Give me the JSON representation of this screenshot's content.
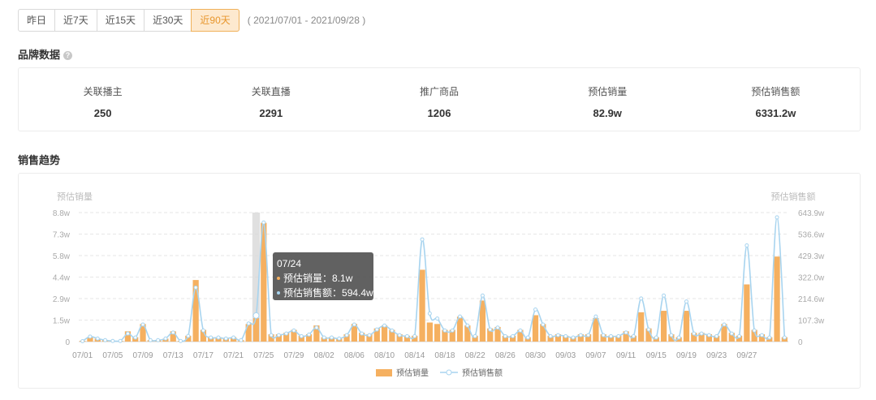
{
  "range": {
    "buttons": [
      "昨日",
      "近7天",
      "近15天",
      "近30天",
      "近90天"
    ],
    "active_index": 4,
    "date_text": "( 2021/07/01 - 2021/09/28 )"
  },
  "brand_section": {
    "title": "品牌数据",
    "help_icon": "question-circle-icon",
    "stats": [
      {
        "label": "关联播主",
        "value": "250"
      },
      {
        "label": "关联直播",
        "value": "2291"
      },
      {
        "label": "推广商品",
        "value": "1206"
      },
      {
        "label": "预估销量",
        "value": "82.9w"
      },
      {
        "label": "预估销售额",
        "value": "6331.2w"
      }
    ]
  },
  "trend_section": {
    "title": "销售趋势"
  },
  "tooltip": {
    "date": "07/24",
    "rows": [
      {
        "label": "预估销量：",
        "value": "8.1w",
        "color": "#f5b060"
      },
      {
        "label": "预估销售额：",
        "value": "594.4w",
        "color": "#a8d4ef"
      }
    ]
  },
  "chart_data": {
    "type": "bar+line",
    "left_axis_title": "预估销量",
    "right_axis_title": "预估销售额",
    "left_ticks": [
      "0",
      "1.5w",
      "2.9w",
      "4.4w",
      "5.8w",
      "7.3w",
      "8.8w"
    ],
    "right_ticks": [
      "0",
      "107.3w",
      "214.6w",
      "322.0w",
      "429.3w",
      "536.6w",
      "643.9w"
    ],
    "ylim_left": [
      0,
      8.8
    ],
    "ylim_right": [
      0,
      643.9
    ],
    "x_tick_labels": [
      "07/01",
      "07/05",
      "07/09",
      "07/13",
      "07/17",
      "07/21",
      "07/25",
      "07/29",
      "08/02",
      "08/06",
      "08/10",
      "08/14",
      "08/18",
      "08/22",
      "08/26",
      "08/30",
      "09/03",
      "09/07",
      "09/11",
      "09/15",
      "09/19",
      "09/23",
      "09/27"
    ],
    "x_start": "07/01",
    "highlight_index": 23,
    "grid": true,
    "legend_position": "bottom",
    "series": [
      {
        "name": "预估销量",
        "type": "bar",
        "color": "#f5b060",
        "values": [
          0.05,
          0.3,
          0.2,
          0.1,
          0.05,
          0.05,
          0.7,
          0.3,
          1.2,
          0.1,
          0.1,
          0.2,
          0.7,
          0.05,
          0.4,
          4.2,
          0.8,
          0.3,
          0.3,
          0.2,
          0.3,
          0.1,
          1.2,
          1.6,
          8.1,
          0.5,
          0.5,
          0.6,
          0.8,
          0.4,
          0.5,
          1.1,
          0.3,
          0.3,
          0.2,
          0.5,
          1.2,
          0.6,
          0.5,
          0.9,
          1.1,
          0.8,
          0.5,
          0.4,
          0.4,
          4.9,
          1.3,
          1.2,
          0.8,
          0.8,
          1.7,
          1.1,
          0.4,
          2.8,
          0.9,
          1.0,
          0.4,
          0.4,
          0.8,
          0.3,
          1.8,
          1.2,
          0.4,
          0.5,
          0.4,
          0.3,
          0.5,
          0.5,
          1.6,
          0.5,
          0.4,
          0.4,
          0.7,
          0.4,
          2.0,
          0.9,
          0.3,
          2.1,
          0.5,
          0.3,
          2.1,
          0.6,
          0.6,
          0.5,
          0.4,
          1.2,
          0.6,
          0.4,
          3.9,
          0.8,
          0.5,
          0.3,
          5.8,
          0.3
        ]
      },
      {
        "name": "预估销售额",
        "type": "line",
        "color": "#a8d4ef",
        "values": [
          2,
          25,
          15,
          7,
          3,
          3,
          40,
          20,
          85,
          7,
          7,
          15,
          45,
          3,
          28,
          270,
          55,
          20,
          20,
          15,
          20,
          7,
          90,
          130,
          594.4,
          32,
          32,
          40,
          55,
          27,
          35,
          70,
          20,
          20,
          15,
          32,
          85,
          40,
          32,
          60,
          80,
          55,
          32,
          27,
          27,
          510,
          140,
          115,
          55,
          55,
          125,
          80,
          27,
          230,
          60,
          70,
          27,
          27,
          55,
          20,
          160,
          85,
          27,
          32,
          27,
          20,
          32,
          32,
          125,
          32,
          27,
          27,
          45,
          27,
          215,
          60,
          20,
          230,
          32,
          20,
          200,
          40,
          40,
          32,
          27,
          85,
          40,
          27,
          480,
          55,
          32,
          20,
          620,
          20
        ]
      }
    ]
  }
}
